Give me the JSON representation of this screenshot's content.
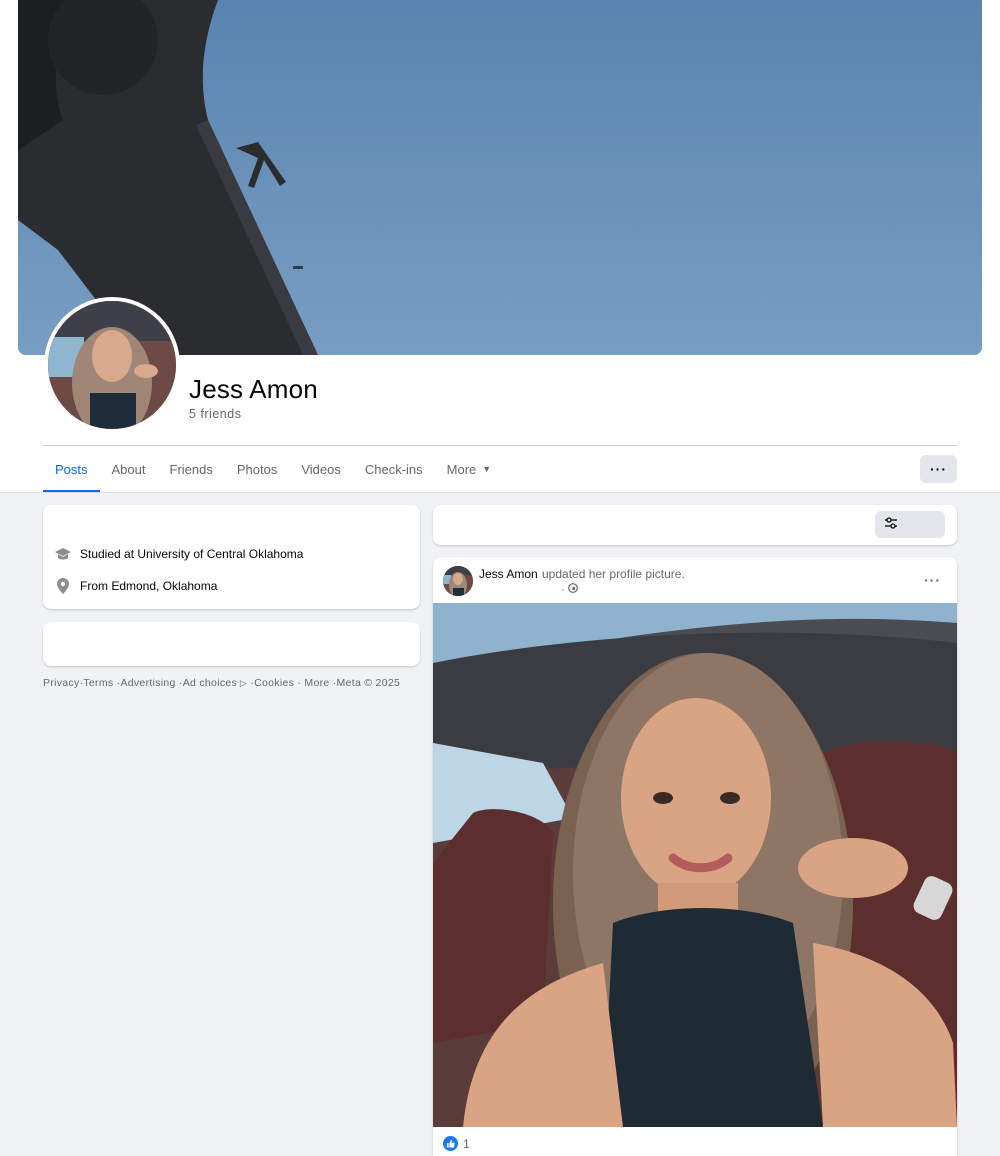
{
  "profile": {
    "name": "Jess Amon",
    "friends": "5 friends"
  },
  "tabs": [
    {
      "label": "Posts",
      "active": true
    },
    {
      "label": "About"
    },
    {
      "label": "Friends"
    },
    {
      "label": "Photos"
    },
    {
      "label": "Videos"
    },
    {
      "label": "Check-ins"
    },
    {
      "label": "More"
    }
  ],
  "icons": {
    "more_options": "ellipsis-icon",
    "education": "graduation-cap-icon",
    "hometown": "location-pin-icon",
    "filters": "sliders-icon",
    "privacy": "globe-icon",
    "like": "thumbs-up-icon",
    "ad_choices": "ad-choices-icon"
  },
  "intro": {
    "education": "Studied at University of Central Oklahoma",
    "hometown": "From Edmond, Oklahoma"
  },
  "footer": {
    "privacy": "Privacy",
    "terms": "Terms",
    "advertising": "Advertising",
    "ad_choices": "Ad choices",
    "cookies": "Cookies",
    "more": "More",
    "meta": "Meta © 2025",
    "separator": "·"
  },
  "post": {
    "author": "Jess Amon",
    "action": "updated her profile picture.",
    "meta_separator": "·",
    "more_label": "···",
    "like_count": "1"
  },
  "colors": {
    "accent": "#0866ff",
    "secondary_text": "#65676b",
    "background": "#f0f2f5",
    "like_blue": "#1877f2"
  }
}
